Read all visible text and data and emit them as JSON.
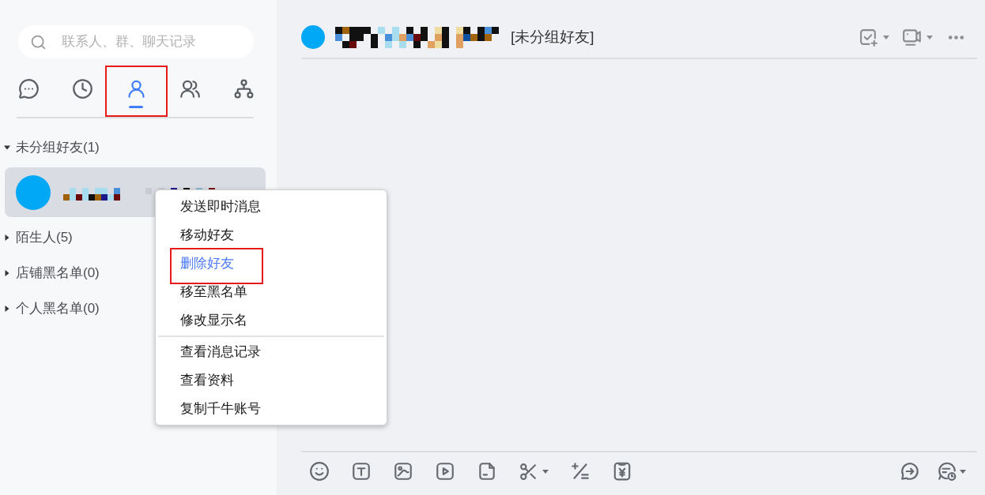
{
  "search": {
    "placeholder": "联系人、群、聊天记录"
  },
  "tabs": [
    {
      "kind": "chats",
      "selected": false,
      "highlighted": false
    },
    {
      "kind": "recent",
      "selected": false,
      "highlighted": false
    },
    {
      "kind": "contacts",
      "selected": true,
      "highlighted": true
    },
    {
      "kind": "groups",
      "selected": false,
      "highlighted": false
    },
    {
      "kind": "organization",
      "selected": false,
      "highlighted": false
    }
  ],
  "groups": [
    {
      "label": "未分组好友(1)",
      "expanded": true,
      "contacts": [
        {
          "selected": true
        }
      ]
    },
    {
      "label": "陌生人(5)",
      "expanded": false
    },
    {
      "label": "店铺黑名单(0)",
      "expanded": false
    },
    {
      "label": "个人黑名单(0)",
      "expanded": false
    }
  ],
  "chat_header": {
    "group_tag": "[未分组好友]"
  },
  "context_menu": {
    "sections": [
      [
        {
          "label": "发送即时消息",
          "selected": false,
          "highlighted": false
        },
        {
          "label": "移动好友",
          "selected": false,
          "highlighted": false
        },
        {
          "label": "删除好友",
          "selected": true,
          "highlighted": true
        },
        {
          "label": "移至黑名单",
          "selected": false,
          "highlighted": false
        },
        {
          "label": "修改显示名",
          "selected": false,
          "highlighted": false
        }
      ],
      [
        {
          "label": "查看消息记录",
          "selected": false,
          "highlighted": false
        },
        {
          "label": "查看资料",
          "selected": false,
          "highlighted": false
        },
        {
          "label": "复制千牛账号",
          "selected": false,
          "highlighted": false
        }
      ]
    ]
  }
}
